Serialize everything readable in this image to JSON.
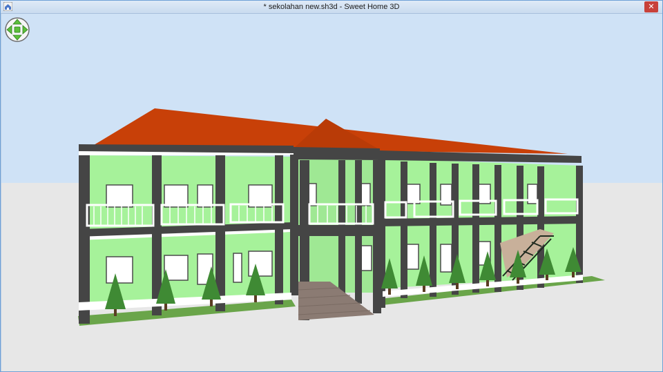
{
  "window": {
    "title": "* sekolahan new.sh3d - Sweet Home 3D",
    "close_glyph": "✕"
  },
  "icons": {
    "app": "sweet-home-3d-icon",
    "navigation": "navigation-arrows-icon",
    "close": "close-icon"
  },
  "colors": {
    "sky": "#cfe2f6",
    "ground": "#e7e7e7",
    "roof": "#c84008",
    "walls": "#a6f29a",
    "pillars": "#454545",
    "railing": "#ffffff",
    "grass": "#6aa54a",
    "tree": "#3f8a34",
    "path": "#8b7b73"
  }
}
